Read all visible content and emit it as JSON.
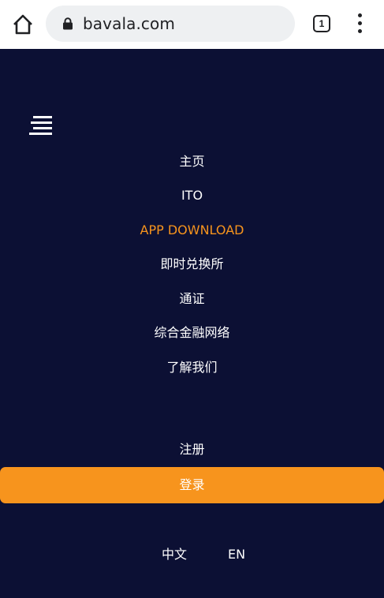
{
  "browser": {
    "url": "bavala.com",
    "tab_count": "1",
    "icons": [
      "home-icon",
      "lock-icon",
      "tab-switcher-icon",
      "more-vert-icon"
    ]
  },
  "site": {
    "menu_icon": "hamburger-menu-icon",
    "nav": [
      {
        "label": "主页"
      },
      {
        "label": "ITO"
      },
      {
        "label": "APP DOWNLOAD",
        "active": true
      },
      {
        "label": "即时兑换所"
      },
      {
        "label": "通证"
      },
      {
        "label": "综合金融网络"
      },
      {
        "label": "了解我们"
      }
    ],
    "register_label": "注册",
    "login_label": "登录",
    "languages": [
      "中文",
      "EN"
    ]
  },
  "colors": {
    "background": "#0c1034",
    "accent": "#f7941d",
    "text": "#ffffff"
  }
}
